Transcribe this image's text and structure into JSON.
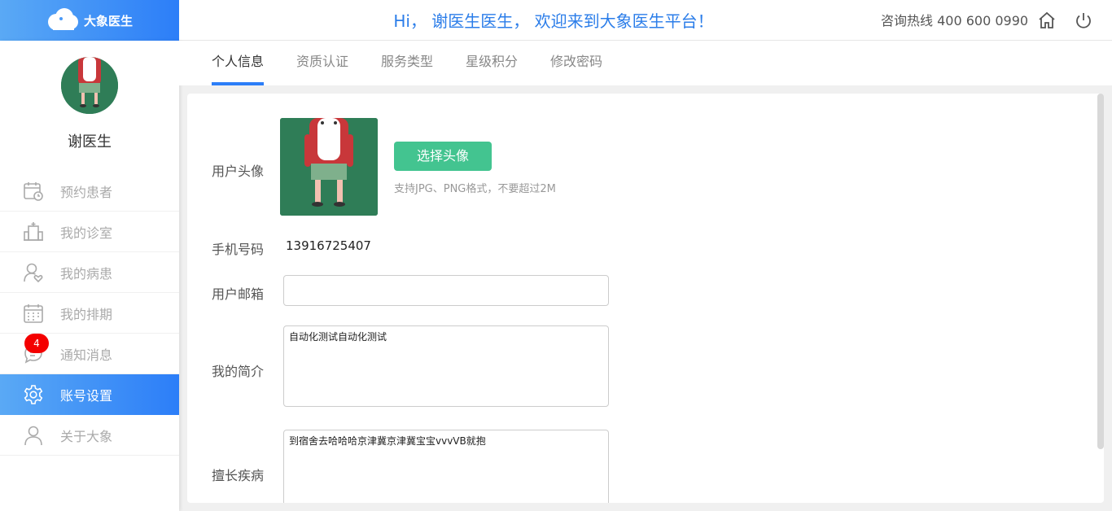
{
  "header": {
    "logo_text": "大象医生",
    "welcome": "Hi， 谢医生医生， 欢迎来到大象医生平台！",
    "hotline": "咨询热线 400 600 0990",
    "home_icon": "home-icon",
    "power_icon": "power-icon"
  },
  "sidebar": {
    "doctor_name": "谢医生",
    "items": [
      {
        "label": "预约患者",
        "icon": "calendar-clock-icon"
      },
      {
        "label": "我的诊室",
        "icon": "hospital-building-icon"
      },
      {
        "label": "我的病患",
        "icon": "patient-heart-icon"
      },
      {
        "label": "我的排期",
        "icon": "schedule-calendar-icon"
      },
      {
        "label": "通知消息",
        "icon": "chat-bubble-icon",
        "badge": "4"
      },
      {
        "label": "账号设置",
        "icon": "gear-icon",
        "active": true
      },
      {
        "label": "关于大象",
        "icon": "user-icon"
      }
    ]
  },
  "tabs": [
    {
      "label": "个人信息",
      "active": true
    },
    {
      "label": "资质认证"
    },
    {
      "label": "服务类型"
    },
    {
      "label": "星级积分"
    },
    {
      "label": "修改密码"
    }
  ],
  "form": {
    "avatar_label": "用户头像",
    "choose_button": "选择头像",
    "hint": "支持JPG、PNG格式，不要超过2M",
    "phone_label": "手机号码",
    "phone_value": "13916725407",
    "email_label": "用户邮箱",
    "email_value": "",
    "intro_label": "我的简介",
    "intro_value": "自动化测试自动化测试",
    "specialty_label": "擅长疾病",
    "specialty_value": "到宿舍去哈哈哈京津冀京津冀宝宝vvvVB就抱"
  },
  "colors": {
    "brand_blue": "#2c7ef8",
    "button_green": "#43c490",
    "badge_red": "#f40000"
  }
}
